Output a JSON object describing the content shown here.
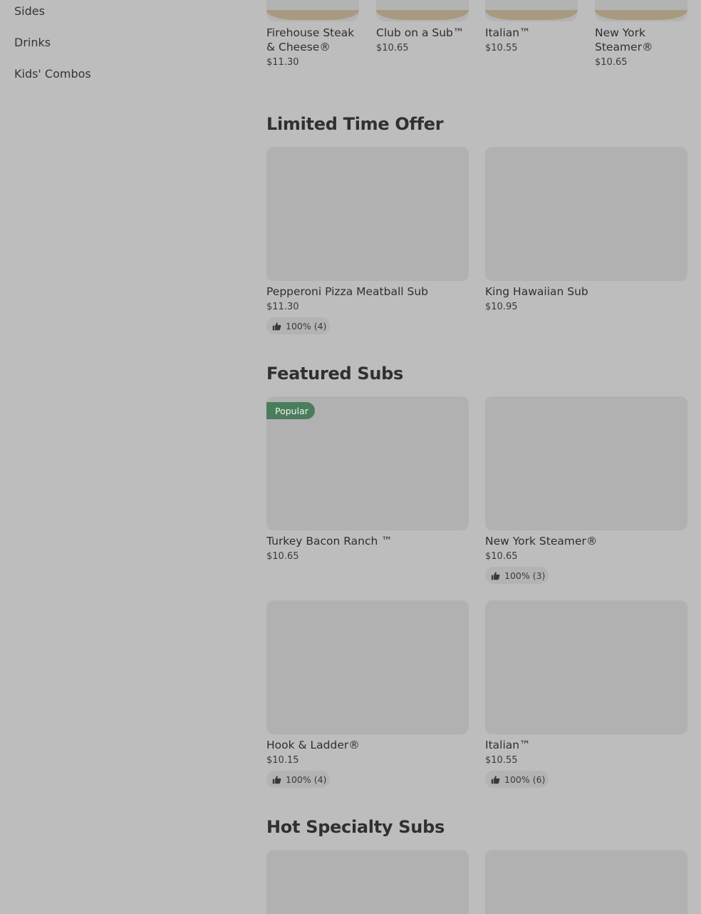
{
  "sidebar": {
    "links": [
      "Sides",
      "Drinks",
      "Kids' Combos"
    ]
  },
  "carousel": [
    {
      "name": "Firehouse Steak & Cheese®",
      "price": "$11.30"
    },
    {
      "name": "Club on a Sub™",
      "price": "$10.65"
    },
    {
      "name": "Italian™",
      "price": "$10.55"
    },
    {
      "name": "New York Steamer®",
      "price": "$10.65"
    }
  ],
  "sections": {
    "limited": {
      "title": "Limited Time Offer",
      "items": [
        {
          "name": "Pepperoni Pizza Meatball Sub",
          "price": "$11.30",
          "rating": "100% (4)"
        },
        {
          "name": "King Hawaiian Sub",
          "price": "$10.95"
        }
      ]
    },
    "featured": {
      "title": "Featured Subs",
      "items": [
        {
          "name": "Turkey Bacon Ranch ™",
          "price": "$10.65",
          "badge": "Popular"
        },
        {
          "name": "New York Steamer®",
          "price": "$10.65",
          "rating": "100% (3)"
        },
        {
          "name": "Hook & Ladder®",
          "price": "$10.15",
          "rating": "100% (4)"
        },
        {
          "name": "Italian™",
          "price": "$10.55",
          "rating": "100% (6)"
        }
      ]
    },
    "hot": {
      "title": "Hot Specialty Subs"
    }
  },
  "icons": {
    "rating": "thumbs-up-icon"
  },
  "colors": {
    "badge_bg": "#4a7d5c",
    "overlay_bg": "#bdbdbd"
  }
}
